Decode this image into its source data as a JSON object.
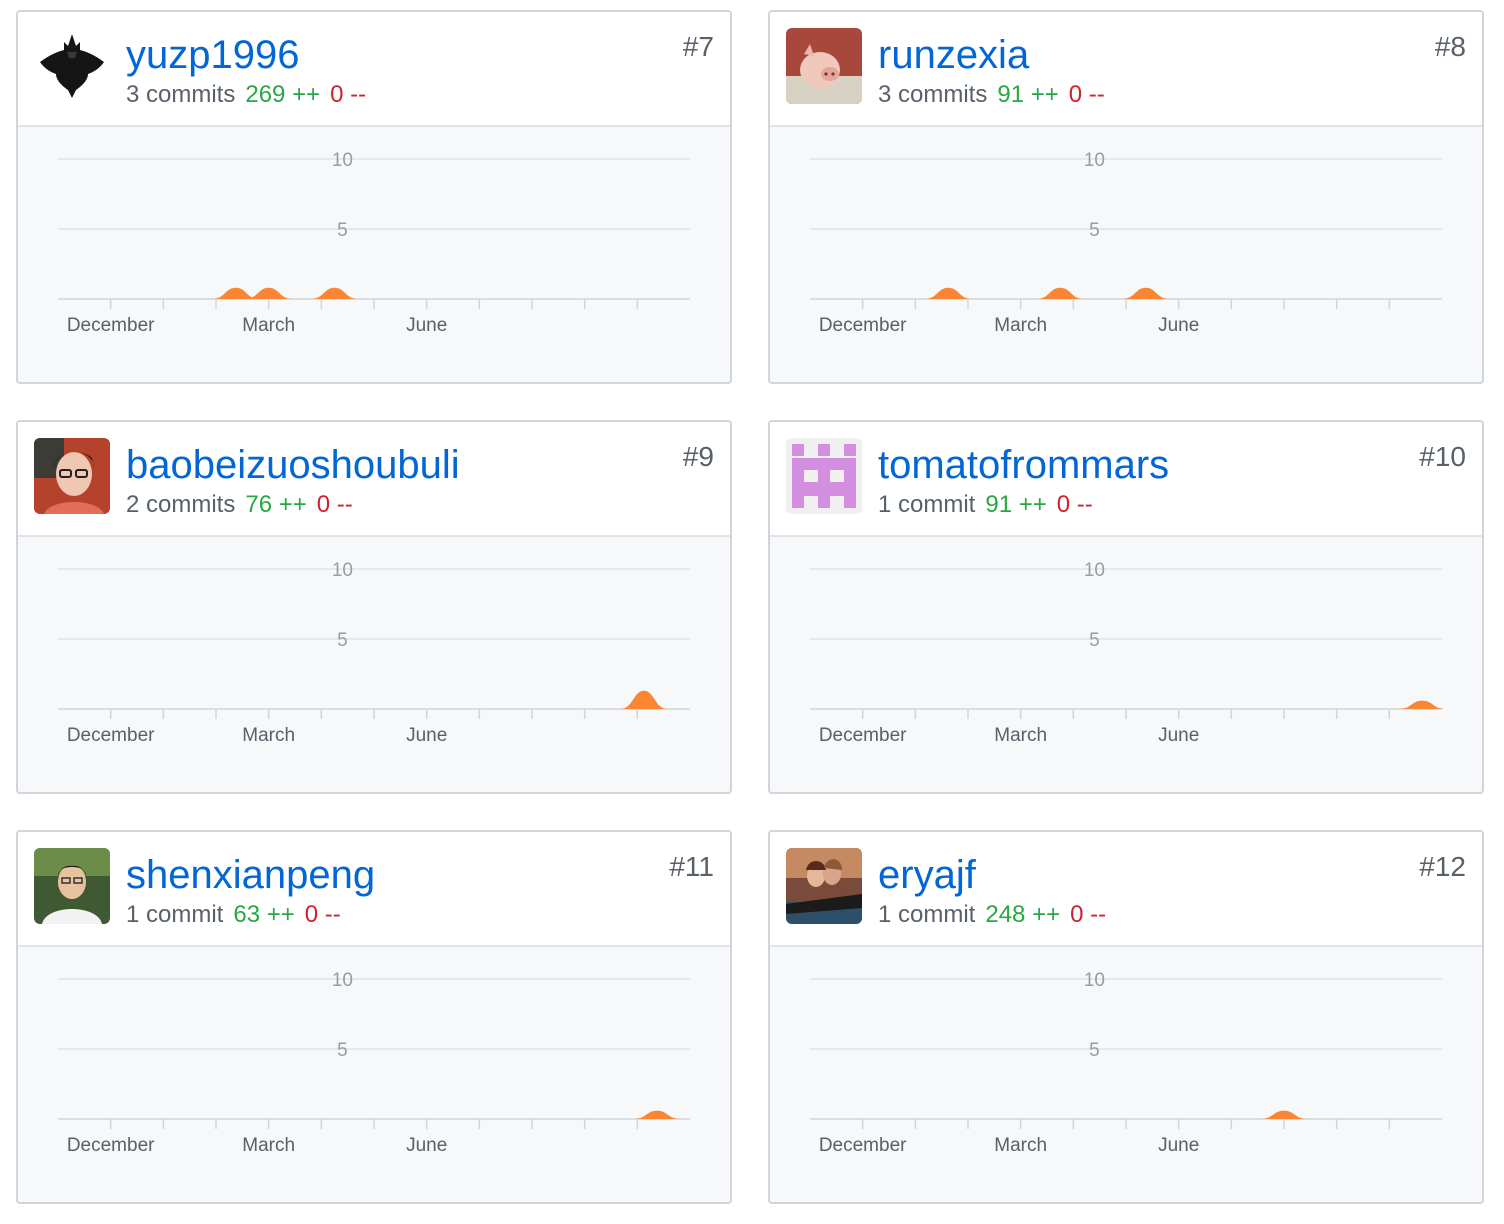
{
  "cards": [
    {
      "username": "yuzp1996",
      "rank": "#7",
      "commits": "3 commits",
      "additions": "269 ++",
      "deletions": "0 --",
      "avatar": "batman-avatar",
      "chart_data": {
        "type": "area",
        "x_axis": "week",
        "y_ticks": [
          "10",
          "5"
        ],
        "x_ticks": [
          "December",
          "March",
          "June"
        ],
        "ylim": [
          0,
          10
        ],
        "peaks": [
          {
            "week": 13.5,
            "value": 0.8
          },
          {
            "week": 16,
            "value": 0.8
          },
          {
            "week": 21,
            "value": 0.8
          }
        ]
      }
    },
    {
      "username": "runzexia",
      "rank": "#8",
      "commits": "3 commits",
      "additions": "91 ++",
      "deletions": "0 --",
      "avatar": "pig-avatar",
      "chart_data": {
        "type": "area",
        "x_axis": "week",
        "y_ticks": [
          "10",
          "5"
        ],
        "x_ticks": [
          "December",
          "March",
          "June"
        ],
        "ylim": [
          0,
          10
        ],
        "peaks": [
          {
            "week": 10.5,
            "value": 0.8
          },
          {
            "week": 19,
            "value": 0.8
          },
          {
            "week": 25.5,
            "value": 0.8
          }
        ]
      }
    },
    {
      "username": "baobeizuoshoubuli",
      "rank": "#9",
      "commits": "2 commits",
      "additions": "76 ++",
      "deletions": "0 --",
      "avatar": "woman-glasses-avatar",
      "chart_data": {
        "type": "area",
        "x_axis": "week",
        "y_ticks": [
          "10",
          "5"
        ],
        "x_ticks": [
          "December",
          "March",
          "June"
        ],
        "ylim": [
          0,
          10
        ],
        "peaks": [
          {
            "week": 44.5,
            "value": 1.3
          }
        ]
      }
    },
    {
      "username": "tomatofrommars",
      "rank": "#10",
      "commits": "1 commit",
      "additions": "91 ++",
      "deletions": "0 --",
      "avatar": "identicon-avatar",
      "chart_data": {
        "type": "area",
        "x_axis": "week",
        "y_ticks": [
          "10",
          "5"
        ],
        "x_ticks": [
          "December",
          "March",
          "June"
        ],
        "ylim": [
          0,
          10
        ],
        "peaks": [
          {
            "week": 46.5,
            "value": 0.6
          }
        ]
      }
    },
    {
      "username": "shenxianpeng",
      "rank": "#11",
      "commits": "1 commit",
      "additions": "63 ++",
      "deletions": "0 --",
      "avatar": "man-portrait-avatar",
      "chart_data": {
        "type": "area",
        "x_axis": "week",
        "y_ticks": [
          "10",
          "5"
        ],
        "x_ticks": [
          "December",
          "March",
          "June"
        ],
        "ylim": [
          0,
          10
        ],
        "peaks": [
          {
            "week": 45.5,
            "value": 0.6
          }
        ]
      }
    },
    {
      "username": "eryajf",
      "rank": "#12",
      "commits": "1 commit",
      "additions": "248 ++",
      "deletions": "0 --",
      "avatar": "titanic-avatar",
      "chart_data": {
        "type": "area",
        "x_axis": "week",
        "y_ticks": [
          "10",
          "5"
        ],
        "x_ticks": [
          "December",
          "March",
          "June"
        ],
        "ylim": [
          0,
          10
        ],
        "peaks": [
          {
            "week": 36,
            "value": 0.6
          }
        ]
      }
    }
  ],
  "colors": {
    "area": "#fb8532",
    "link": "#0366d6",
    "added": "#28a745",
    "deleted": "#cb2431",
    "muted": "#586069"
  }
}
